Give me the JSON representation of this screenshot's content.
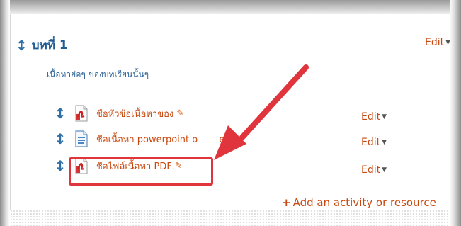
{
  "section": {
    "title": "บทที่ 1",
    "summary": "เนื้อหาย่อๆ ของบทเรียนนั้นๆ",
    "edit_label": "Edit"
  },
  "activities": [
    {
      "name": "ชื่อหัวข้อเนื้อหาของ",
      "icon": "pdf-icon",
      "edit_label": "Edit"
    },
    {
      "name": "ชื่อเนื้อหา powerpoint o",
      "name_hidden_tail": "e",
      "icon": "document-icon",
      "edit_label": "Edit"
    },
    {
      "name": "ชื่อไฟล์เนื้อหา PDF",
      "icon": "pdf-icon",
      "edit_label": "Edit"
    }
  ],
  "add_activity_label": "Add an activity or resource",
  "colors": {
    "accent": "#c9480f",
    "heading": "#1e5c93",
    "annotation": "#e0353c"
  }
}
